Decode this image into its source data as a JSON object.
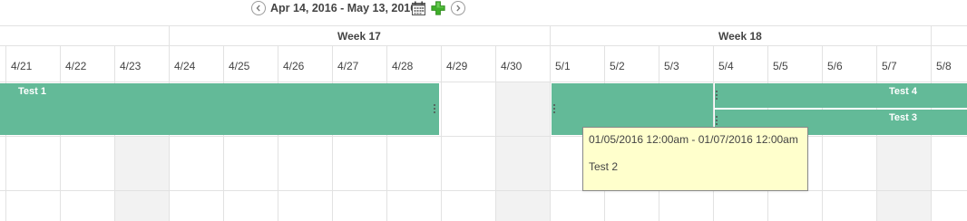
{
  "toolbar": {
    "date_range": "Apr 14, 2016 - May 13, 2016",
    "prev_icon": "chevron-left-icon",
    "next_icon": "chevron-right-icon",
    "calendar_icon": "calendar-icon",
    "add_icon": "plus-icon",
    "add_color": "#3fae2a"
  },
  "weeks": [
    "Week 17",
    "Week 18"
  ],
  "days": [
    "4/21",
    "4/22",
    "4/23",
    "4/24",
    "4/25",
    "4/26",
    "4/27",
    "4/28",
    "4/29",
    "4/30",
    "5/1",
    "5/2",
    "5/3",
    "5/4",
    "5/5",
    "5/6",
    "5/7",
    "5/8"
  ],
  "events": {
    "test1": "Test 1",
    "test2": "",
    "test3": "Test 3",
    "test4": "Test 4",
    "color": "#63ba98"
  },
  "tooltip": {
    "range": "01/05/2016 12:00am - 01/07/2016 12:00am",
    "title": "Test 2",
    "background": "#ffffcc"
  }
}
